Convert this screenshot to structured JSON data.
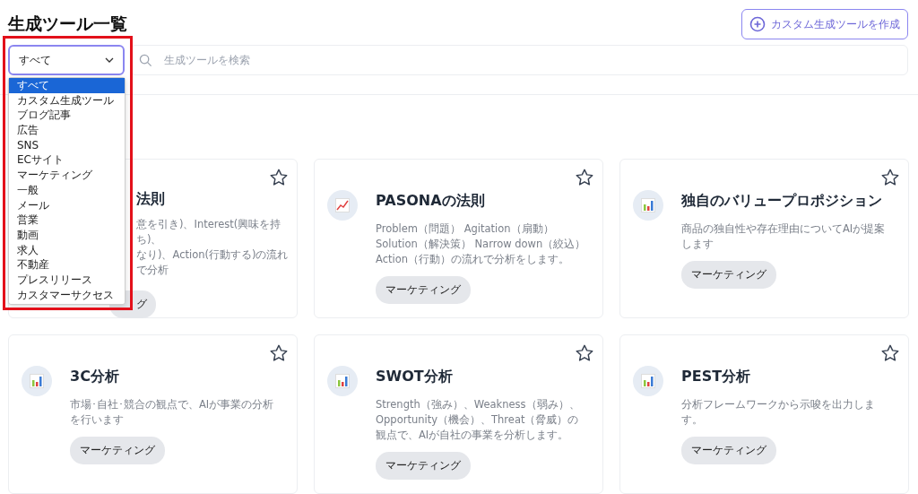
{
  "page_title": "生成ツール一覧",
  "create_button": {
    "label": "カスタム生成ツールを作成"
  },
  "filter": {
    "value": "すべて",
    "expanded": true,
    "options": [
      {
        "label": "すべて",
        "selected": true
      },
      {
        "label": "カスタム生成ツール",
        "selected": false
      },
      {
        "label": "ブログ記事",
        "selected": false
      },
      {
        "label": "広告",
        "selected": false
      },
      {
        "label": "SNS",
        "selected": false
      },
      {
        "label": "ECサイト",
        "selected": false
      },
      {
        "label": "マーケティング",
        "selected": false
      },
      {
        "label": "一般",
        "selected": false
      },
      {
        "label": "メール",
        "selected": false
      },
      {
        "label": "営業",
        "selected": false
      },
      {
        "label": "動画",
        "selected": false
      },
      {
        "label": "求人",
        "selected": false
      },
      {
        "label": "不動産",
        "selected": false
      },
      {
        "label": "プレスリリース",
        "selected": false
      },
      {
        "label": "カスタマーサクセス",
        "selected": false
      }
    ]
  },
  "search": {
    "placeholder": "生成ツールを検索"
  },
  "highlight": true,
  "cards": [
    {
      "kind": "covered",
      "title": "法則",
      "description": [
        "意を引き)、Interest(興味を持ち)、",
        "なり)、Action(行動する)の流れで分析"
      ],
      "tag": "グ",
      "starred": false
    },
    {
      "kind": "line-chart",
      "title": "PASONAの法則",
      "description": [
        "Problem（問題） Agitation（扇動） Solution（解決策） Narrow down（絞込） Action（行動）の流れで分析をします。"
      ],
      "tag": "マーケティング",
      "starred": false
    },
    {
      "kind": "bar-chart",
      "title": "独自のバリュープロポジション",
      "description": [
        "商品の独自性や存在理由についてAIが提案します"
      ],
      "tag": "マーケティング",
      "starred": false
    },
    {
      "kind": "bar-chart",
      "title": "3C分析",
      "description": [
        "市場･自社･競合の観点で、AIが事業の分析を行います"
      ],
      "tag": "マーケティング",
      "starred": false
    },
    {
      "kind": "bar-chart",
      "title": "SWOT分析",
      "description": [
        "Strength（強み）、Weakness（弱み）、Opportunity（機会）、Threat（脅威）の観点で、AIが自社の事業を分析します。"
      ],
      "tag": "マーケティング",
      "starred": false
    },
    {
      "kind": "bar-chart",
      "title": "PEST分析",
      "description": [
        "分析フレームワークから示唆を出力します。"
      ],
      "tag": "マーケティング",
      "starred": false
    }
  ]
}
